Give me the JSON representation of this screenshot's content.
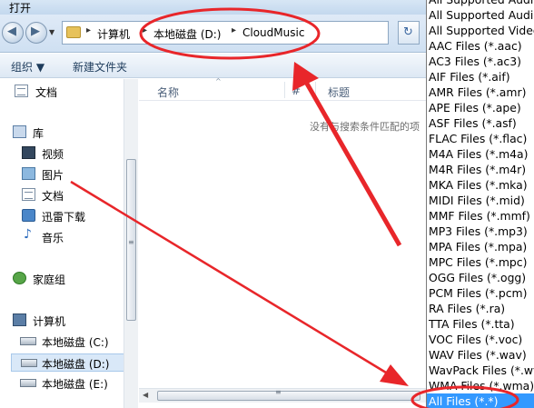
{
  "window": {
    "title": "打开"
  },
  "nav": {
    "back_glyph": "◀",
    "forward_glyph": "▶",
    "dropdown_glyph": "▼",
    "refresh_glyph": "↻"
  },
  "breadcrumb": {
    "items": [
      "计算机",
      "本地磁盘 (D:)",
      "CloudMusic"
    ],
    "separator": "▸"
  },
  "toolbar": {
    "organize": "组织 ▼",
    "new_folder": "新建文件夹"
  },
  "sidebar": {
    "items": [
      {
        "label": "文档",
        "icon": "document-icon"
      },
      {
        "label": "库",
        "icon": "library-icon"
      },
      {
        "label": "视频",
        "icon": "video-icon"
      },
      {
        "label": "图片",
        "icon": "picture-icon"
      },
      {
        "label": "文档",
        "icon": "document-icon"
      },
      {
        "label": "迅雷下载",
        "icon": "download-icon"
      },
      {
        "label": "音乐",
        "icon": "music-icon"
      },
      {
        "label": "家庭组",
        "icon": "homegroup-icon"
      },
      {
        "label": "计算机",
        "icon": "computer-icon"
      },
      {
        "label": "本地磁盘 (C:)",
        "icon": "drive-icon"
      },
      {
        "label": "本地磁盘 (D:)",
        "icon": "drive-icon",
        "selected": true
      },
      {
        "label": "本地磁盘 (E:)",
        "icon": "drive-icon"
      }
    ]
  },
  "columns": {
    "name": "名称",
    "number": "#",
    "title": "标题"
  },
  "empty_message": "没有与搜索条件匹配的项",
  "scroll": {
    "grip": "≡",
    "left_arrow": "◀"
  },
  "file_types": {
    "options": [
      "All Supported Audio",
      "All Supported Audio",
      "All Supported Video",
      "AAC Files (*.aac)",
      "AC3 Files (*.ac3)",
      "AIF Files (*.aif)",
      "AMR Files (*.amr)",
      "APE Files (*.ape)",
      "ASF Files (*.asf)",
      "FLAC Files (*.flac)",
      "M4A Files (*.m4a)",
      "M4R Files (*.m4r)",
      "MKA Files (*.mka)",
      "MIDI Files (*.mid)",
      "MMF Files (*.mmf)",
      "MP3 Files (*.mp3)",
      "MPA Files (*.mpa)",
      "MPC Files (*.mpc)",
      "OGG Files (*.ogg)",
      "PCM Files (*.pcm)",
      "RA Files (*.ra)",
      "TTA Files (*.tta)",
      "VOC Files (*.voc)",
      "WAV Files (*.wav)",
      "WavPack Files (*.wv)",
      "WMA Files (*.wma)",
      "All Files (*.*)"
    ],
    "selected": "All Files (*.*)"
  },
  "colors": {
    "accent": "#3399ff",
    "annotation": "#e8262a"
  }
}
